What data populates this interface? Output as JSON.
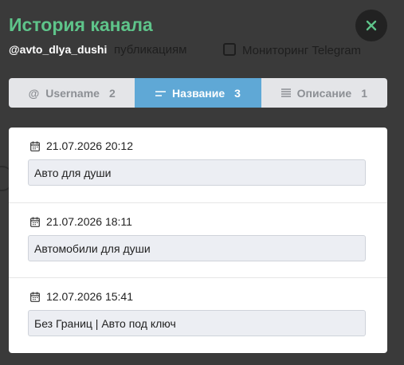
{
  "background": {
    "nav_items": [
      "публикациям",
      "Мониторинг Telegram"
    ]
  },
  "modal": {
    "title": "История канала",
    "subtitle": "@avto_dlya_dushi",
    "close_icon": "close-icon",
    "accent_color": "#5ec48a"
  },
  "tabs": [
    {
      "icon": "at-icon",
      "label": "Username",
      "count": "2",
      "active": false
    },
    {
      "icon": "title-icon",
      "label": "Название",
      "count": "3",
      "active": true
    },
    {
      "icon": "description-icon",
      "label": "Описание",
      "count": "1",
      "active": false
    }
  ],
  "history": [
    {
      "date": "21.07.2026 20:12",
      "value": "Авто для души"
    },
    {
      "date": "21.07.2026 18:11",
      "value": "Автомобили для души"
    },
    {
      "date": "12.07.2026 15:41",
      "value": "Без Границ | Авто под ключ"
    }
  ]
}
